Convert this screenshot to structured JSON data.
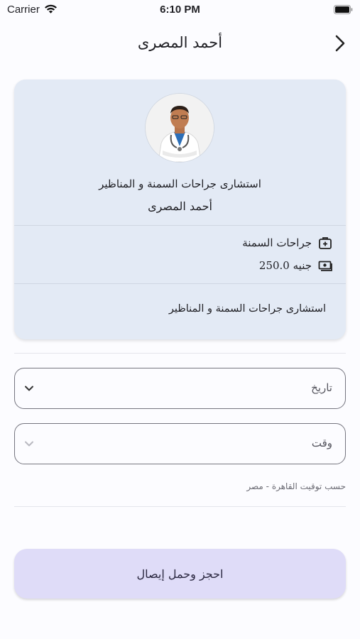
{
  "status_bar": {
    "carrier": "Carrier",
    "time": "6:10 PM"
  },
  "nav": {
    "title": "أحمد المصرى",
    "back_icon": "chevron-right-icon"
  },
  "doctor": {
    "title": "استشارى جراحات السمنة و المناظير",
    "name": "أحمد المصرى",
    "specialty": "جراحات السمنة",
    "specialty_icon": "medical-kit-icon",
    "price": "250.0 جنيه",
    "price_icon": "cash-icon",
    "bio": "استشارى جراحات السمنة و المناظير"
  },
  "booking": {
    "date_label": "تاريخ",
    "time_label": "وقت",
    "timezone_note": "حسب توقيت القاهرة - مصر",
    "submit_label": "احجز وحمل إيصال"
  },
  "colors": {
    "card_bg": "#e3eaf5",
    "button_bg": "#dfdcf8",
    "page_bg": "#fcfcff"
  }
}
